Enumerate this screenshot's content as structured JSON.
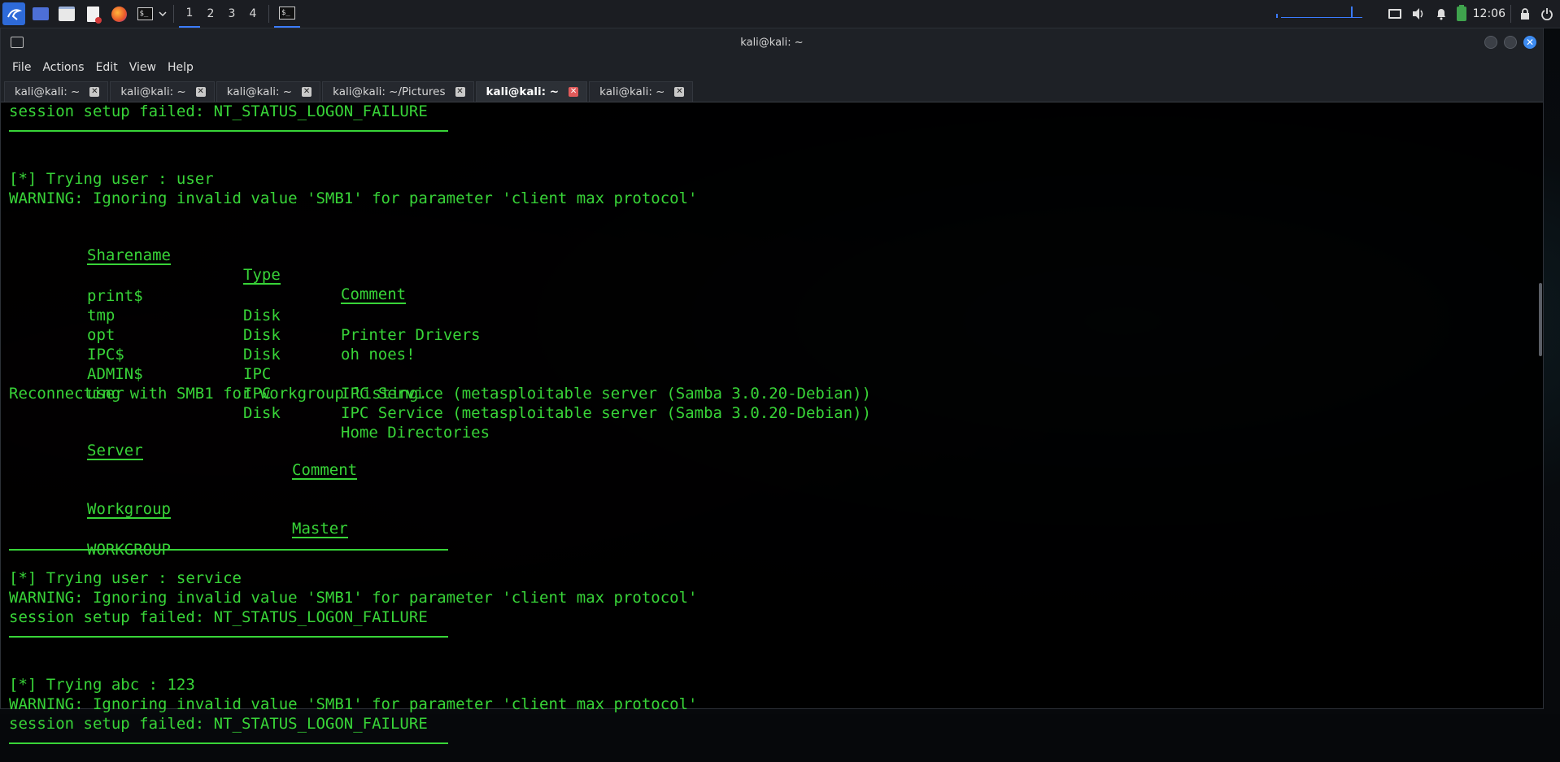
{
  "panel": {
    "workspaces": [
      "1",
      "2",
      "3",
      "4"
    ],
    "clock": "12:06"
  },
  "window": {
    "title": "kali@kali: ~",
    "menu": [
      "File",
      "Actions",
      "Edit",
      "View",
      "Help"
    ],
    "tabs": [
      {
        "label": "kali@kali: ~",
        "active": false
      },
      {
        "label": "kali@kali: ~",
        "active": false
      },
      {
        "label": "kali@kali: ~",
        "active": false
      },
      {
        "label": "kali@kali: ~/Pictures",
        "active": false
      },
      {
        "label": "kali@kali: ~",
        "active": true
      },
      {
        "label": "kali@kali: ~",
        "active": false
      }
    ]
  },
  "terminal": {
    "text_color": "#38d438",
    "l01": "session setup failed: NT_STATUS_LOGON_FAILURE",
    "l03": "[*] Trying user : user",
    "l04": "WARNING: Ignoring invalid value 'SMB1' for parameter 'client max protocol'",
    "share_headers": {
      "name": "Sharename",
      "type": "Type",
      "comment": "Comment"
    },
    "shares": [
      {
        "name": "print$",
        "type": "Disk",
        "comment": "Printer Drivers"
      },
      {
        "name": "tmp",
        "type": "Disk",
        "comment": "oh noes!"
      },
      {
        "name": "opt",
        "type": "Disk",
        "comment": ""
      },
      {
        "name": "IPC$",
        "type": "IPC",
        "comment": "IPC Service (metasploitable server (Samba 3.0.20-Debian))"
      },
      {
        "name": "ADMIN$",
        "type": "IPC",
        "comment": "IPC Service (metasploitable server (Samba 3.0.20-Debian))"
      },
      {
        "name": "user",
        "type": "Disk",
        "comment": "Home Directories"
      }
    ],
    "reconnect": "Reconnecting with SMB1 for workgroup listing.",
    "server_headers": {
      "server": "Server",
      "comment": "Comment"
    },
    "workgroup_headers": {
      "workgroup": "Workgroup",
      "master": "Master"
    },
    "workgroup_value": "WORKGROUP",
    "l_try2": "[*] Trying user : service",
    "l_warn2": "WARNING: Ignoring invalid value 'SMB1' for parameter 'client max protocol'",
    "l_fail2": "session setup failed: NT_STATUS_LOGON_FAILURE",
    "l_try3": "[*] Trying abc : 123",
    "l_warn3": "WARNING: Ignoring invalid value 'SMB1' for parameter 'client max protocol'",
    "l_fail3": "session setup failed: NT_STATUS_LOGON_FAILURE"
  }
}
